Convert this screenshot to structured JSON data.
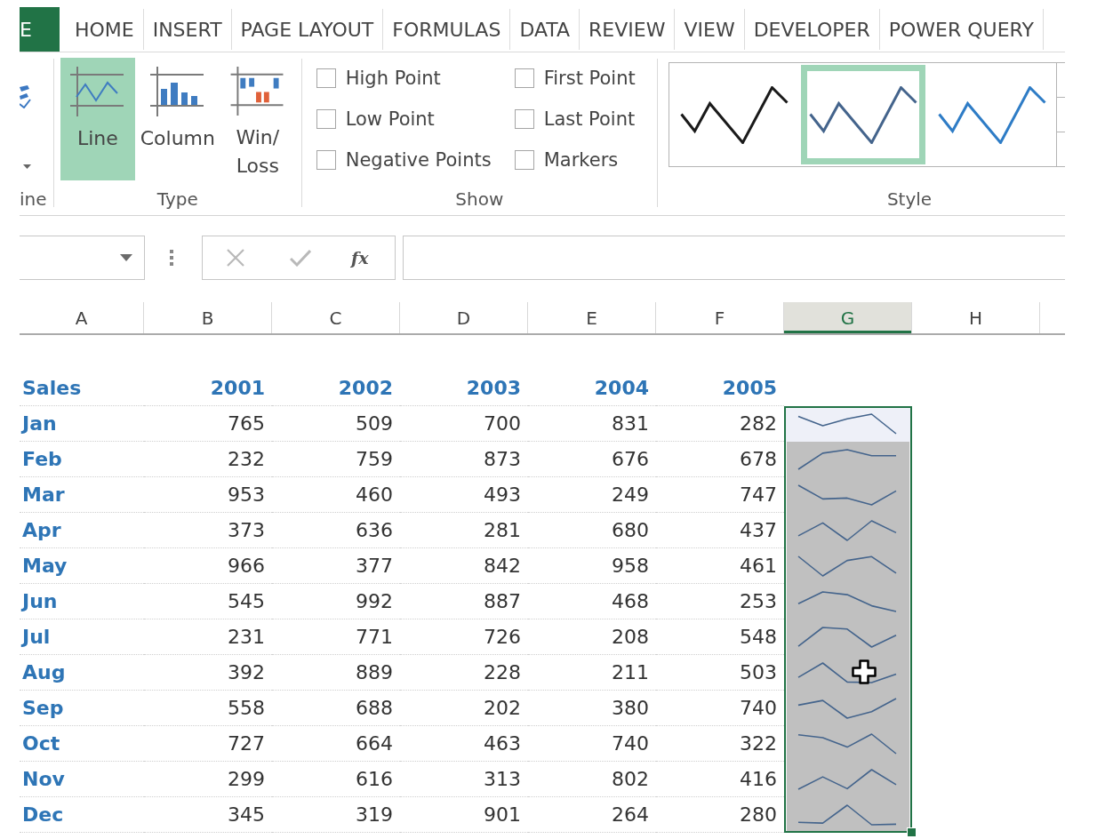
{
  "tabs": [
    {
      "kind": "file",
      "label": "E",
      "selected": false
    },
    {
      "kind": "tab",
      "label": "HOME",
      "selected": false
    },
    {
      "kind": "tab",
      "label": "INSERT",
      "selected": false
    },
    {
      "kind": "tab",
      "label": "PAGE LAYOUT",
      "selected": false
    },
    {
      "kind": "tab",
      "label": "FORMULAS",
      "selected": false
    },
    {
      "kind": "tab",
      "label": "DATA",
      "selected": false
    },
    {
      "kind": "tab",
      "label": "REVIEW",
      "selected": false
    },
    {
      "kind": "tab",
      "label": "VIEW",
      "selected": false
    },
    {
      "kind": "tab",
      "label": "DEVELOPER",
      "selected": false
    },
    {
      "kind": "tab",
      "label": "POWER QUERY",
      "selected": false
    }
  ],
  "ribbon": {
    "sparkline_group": {
      "label": "ine"
    },
    "type_group": {
      "label": "Type",
      "buttons": [
        {
          "kind": "line",
          "lines": [
            "Line"
          ],
          "selected": true
        },
        {
          "kind": "column",
          "lines": [
            "Column"
          ],
          "selected": false
        },
        {
          "kind": "win_loss",
          "lines": [
            "Win/",
            "Loss"
          ],
          "selected": false
        }
      ]
    },
    "show_group": {
      "label": "Show",
      "options": [
        {
          "label": "High Point",
          "checked": false
        },
        {
          "label": "Low Point",
          "checked": false
        },
        {
          "label": "Negative Points",
          "checked": false
        },
        {
          "label": "First Point",
          "checked": false
        },
        {
          "label": "Last Point",
          "checked": false
        },
        {
          "label": "Markers",
          "checked": false
        }
      ]
    },
    "style_group": {
      "label": "Style",
      "styles": [
        {
          "color": "#1a1a1a",
          "selected": false
        },
        {
          "color": "#44648c",
          "selected": true
        },
        {
          "color": "#2e7cc6",
          "selected": false
        }
      ]
    }
  },
  "formula_bar": {
    "cancel": {
      "disabled": true
    },
    "enter": {
      "disabled": true
    },
    "insert_function": "fx"
  },
  "columns": [
    {
      "label": "A",
      "selected": false
    },
    {
      "label": "B",
      "selected": false
    },
    {
      "label": "C",
      "selected": false
    },
    {
      "label": "D",
      "selected": false
    },
    {
      "label": "E",
      "selected": false
    },
    {
      "label": "F",
      "selected": false
    },
    {
      "label": "G",
      "selected": true
    },
    {
      "label": "H",
      "selected": false
    }
  ],
  "sheet": {
    "header": [
      "Sales",
      "2001",
      "2002",
      "2003",
      "2004",
      "2005"
    ],
    "rows": [
      {
        "label": "Jan",
        "values": [
          "765",
          "509",
          "700",
          "831",
          "282"
        ],
        "sparkline": {
          "selected": true,
          "active": true
        },
        "cursor": false
      },
      {
        "label": "Feb",
        "values": [
          "232",
          "759",
          "873",
          "676",
          "678"
        ],
        "sparkline": {
          "selected": true,
          "active": false
        },
        "cursor": false
      },
      {
        "label": "Mar",
        "values": [
          "953",
          "460",
          "493",
          "249",
          "747"
        ],
        "sparkline": {
          "selected": true,
          "active": false
        },
        "cursor": false
      },
      {
        "label": "Apr",
        "values": [
          "373",
          "636",
          "281",
          "680",
          "437"
        ],
        "sparkline": {
          "selected": true,
          "active": false
        },
        "cursor": false
      },
      {
        "label": "May",
        "values": [
          "966",
          "377",
          "842",
          "958",
          "461"
        ],
        "sparkline": {
          "selected": true,
          "active": false
        },
        "cursor": false
      },
      {
        "label": "Jun",
        "values": [
          "545",
          "992",
          "887",
          "468",
          "253"
        ],
        "sparkline": {
          "selected": true,
          "active": false
        },
        "cursor": false
      },
      {
        "label": "Jul",
        "values": [
          "231",
          "771",
          "726",
          "208",
          "548"
        ],
        "sparkline": {
          "selected": true,
          "active": false
        },
        "cursor": false
      },
      {
        "label": "Aug",
        "values": [
          "392",
          "889",
          "228",
          "211",
          "503"
        ],
        "sparkline": {
          "selected": true,
          "active": false
        },
        "cursor": true
      },
      {
        "label": "Sep",
        "values": [
          "558",
          "688",
          "202",
          "380",
          "740"
        ],
        "sparkline": {
          "selected": true,
          "active": false
        },
        "cursor": false
      },
      {
        "label": "Oct",
        "values": [
          "727",
          "664",
          "463",
          "740",
          "322"
        ],
        "sparkline": {
          "selected": true,
          "active": false
        },
        "cursor": false
      },
      {
        "label": "Nov",
        "values": [
          "299",
          "616",
          "313",
          "802",
          "416"
        ],
        "sparkline": {
          "selected": true,
          "active": false
        },
        "cursor": false
      },
      {
        "label": "Dec",
        "values": [
          "345",
          "319",
          "901",
          "264",
          "280"
        ],
        "sparkline": {
          "selected": true,
          "active": false
        },
        "cursor": false
      }
    ]
  }
}
